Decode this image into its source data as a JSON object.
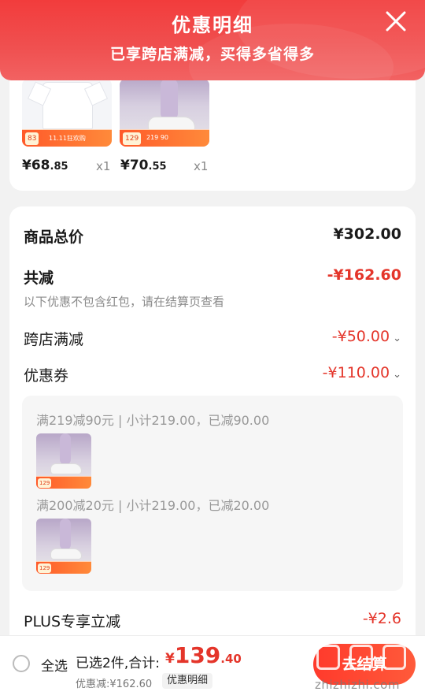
{
  "header": {
    "title": "优惠明细",
    "subtitle": "已享跨店满减，买得多省得多",
    "close_icon": "close-icon"
  },
  "products": [
    {
      "price_main": "¥68",
      "price_dec": ".85",
      "qty": "x1",
      "promo_tag": "83",
      "promo_text": "11.11狂欢购",
      "image": "white-tshirt"
    },
    {
      "price_main": "¥70",
      "price_dec": ".55",
      "qty": "x1",
      "promo_tag": "129",
      "promo_text": "219 90",
      "image": "sneaker-on-foot"
    }
  ],
  "summary": {
    "total_label": "商品总价",
    "total_value": "¥302.00",
    "reduce_label": "共减",
    "reduce_value": "-¥162.60",
    "note": "以下优惠不包含红包，请在结算页查看",
    "cross_store_label": "跨店满减",
    "cross_store_value": "-¥50.00",
    "coupon_label": "优惠券",
    "coupon_value": "-¥110.00",
    "plus_label": "PLUS专享立减",
    "plus_value": "-¥2.6"
  },
  "coupons": [
    {
      "text": "满219减90元 | 小计219.00，已减90.00",
      "thumb_tag": "129"
    },
    {
      "text": "满200减20元 | 小计219.00，已减20.00",
      "thumb_tag": "129"
    }
  ],
  "bottom_bar": {
    "select_all": "全选",
    "selected_text": "已选2件,合计:",
    "currency": "¥",
    "amount_int": "139",
    "amount_dec": ".40",
    "discount_text": "优惠减:¥162.60",
    "detail_chip": "优惠明细",
    "checkout": "去结算"
  },
  "watermark": {
    "site": "zhizhizhi.com"
  },
  "colors": {
    "header_red": "#f23c3c",
    "accent_red": "#e4352a",
    "gray_text": "#8a8a8a"
  }
}
